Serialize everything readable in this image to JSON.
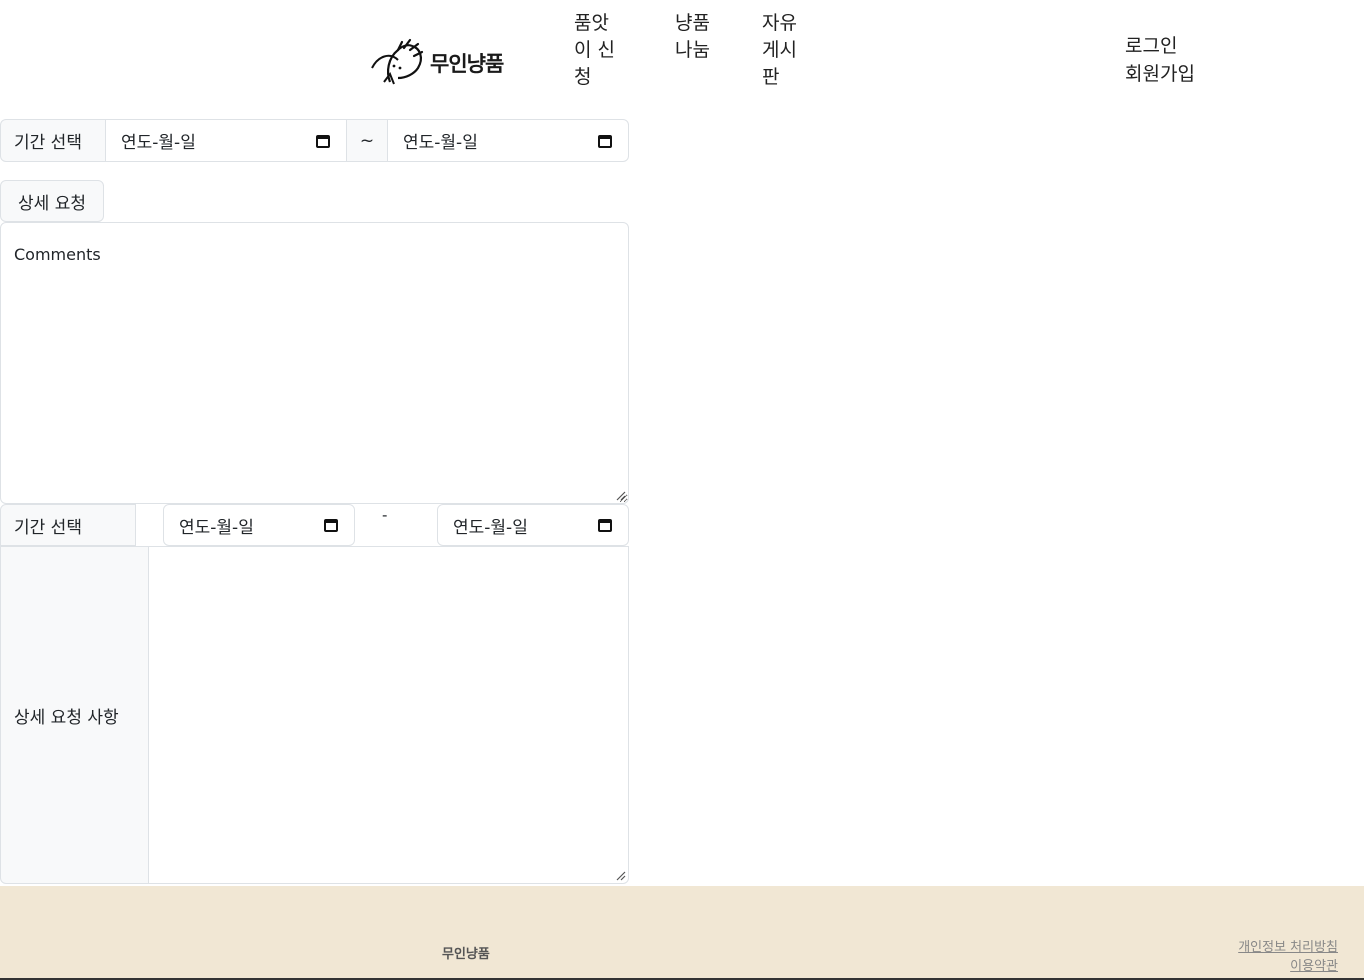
{
  "header": {
    "logo_text": "무인냥품",
    "nav": [
      {
        "label": "품앗이 신청"
      },
      {
        "label": "냥품나눔"
      },
      {
        "label": "자유게시판"
      }
    ],
    "auth": {
      "login": "로그인",
      "signup": "회원가입"
    }
  },
  "form1": {
    "period_label": "기간 선택",
    "start_placeholder": "연도-월-일",
    "separator": "~",
    "end_placeholder": "연도-월-일",
    "detail_button": "상세 요청",
    "comments_placeholder": "Comments"
  },
  "form2": {
    "period_label": "기간 선택",
    "start_placeholder": "연도-월-일",
    "separator": "-",
    "end_placeholder": "연도-월-일",
    "detail_label": "상세 요청 사항"
  },
  "footer": {
    "brand": "무인냥품",
    "links": [
      "개인정보 처리방침",
      "이용약관"
    ]
  },
  "colors": {
    "footer_bg": "#f1e7d4",
    "addon_bg": "#f8f9fa",
    "border": "#dee2e6"
  }
}
